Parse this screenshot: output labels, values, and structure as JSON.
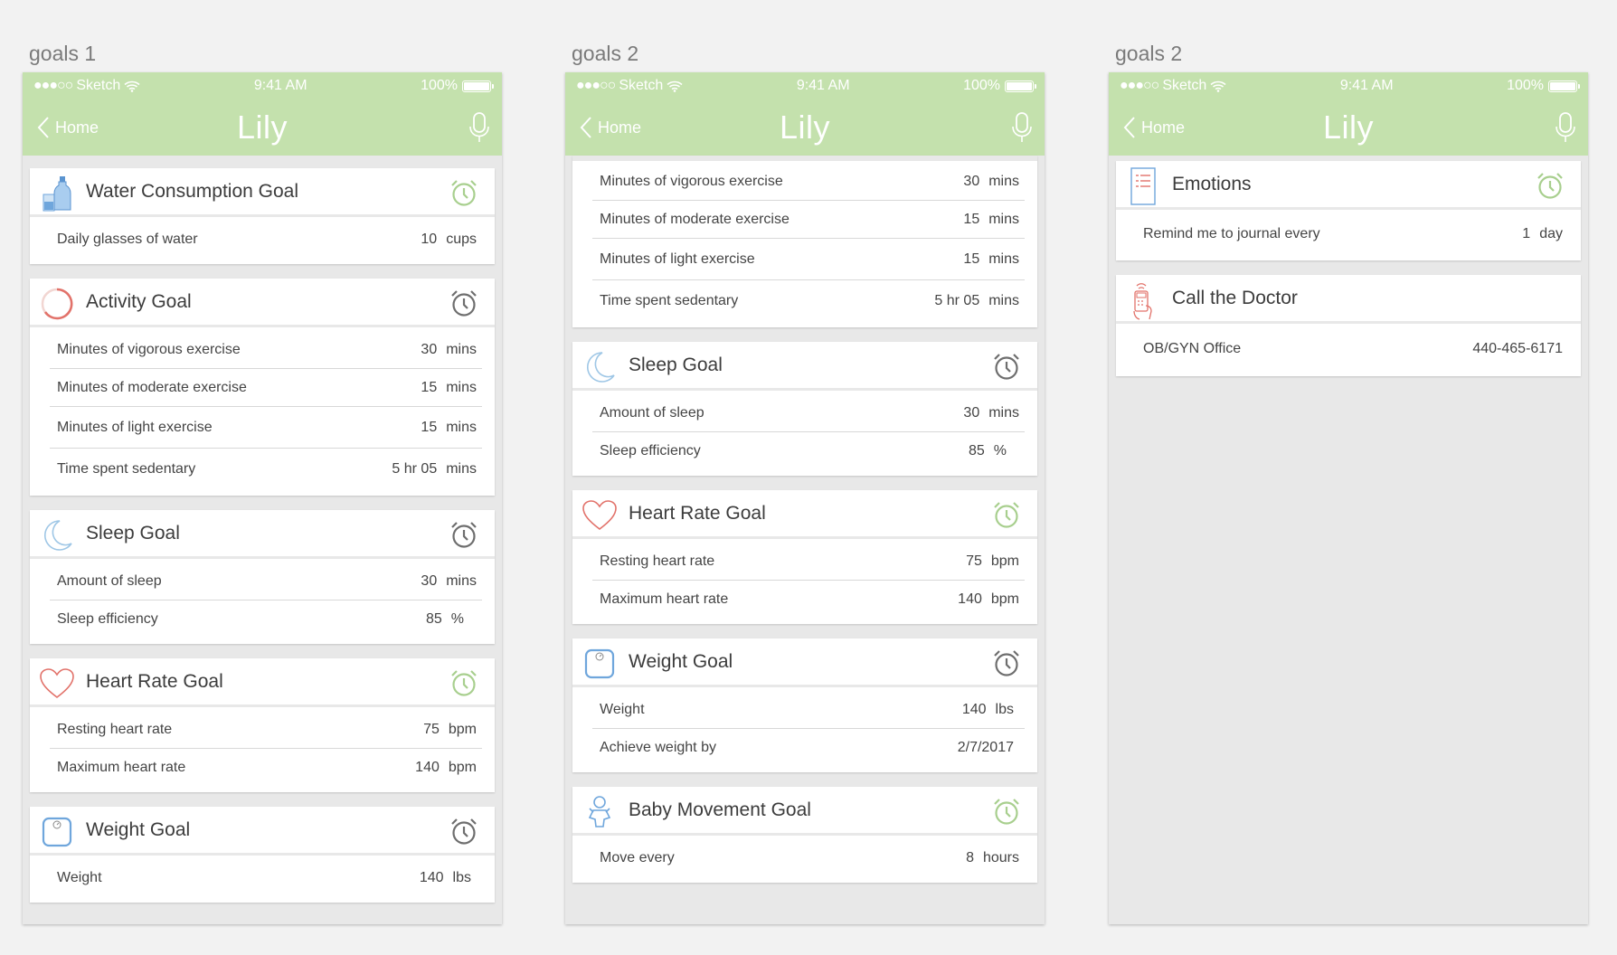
{
  "artboards": [
    {
      "label": "goals 1"
    },
    {
      "label": "goals 2"
    },
    {
      "label": "goals 2"
    }
  ],
  "status": {
    "carrier": "Sketch",
    "time": "9:41 AM",
    "battery": "100%"
  },
  "nav": {
    "back_label": "Home",
    "title": "Lily"
  },
  "colors": {
    "header_green": "#c4e1ad",
    "alarm_green": "#a8cf8e",
    "alarm_gray": "#6e6e6e",
    "heart_red": "#e2726a",
    "moon_blue": "#9fc7e6"
  },
  "screen1": {
    "water": {
      "title": "Water Consumption Goal",
      "rows": [
        {
          "label": "Daily glasses of water",
          "value": "10",
          "unit": "cups"
        }
      ]
    },
    "activity": {
      "title": "Activity Goal",
      "rows": [
        {
          "label": "Minutes of vigorous exercise",
          "value": "30",
          "unit": "mins"
        },
        {
          "label": "Minutes of moderate exercise",
          "value": "15",
          "unit": "mins"
        },
        {
          "label": "Minutes of light exercise",
          "value": "15",
          "unit": "mins"
        },
        {
          "label": "Time spent sedentary",
          "value": "5 hr  05",
          "unit": "mins"
        }
      ]
    },
    "sleep": {
      "title": "Sleep Goal",
      "rows": [
        {
          "label": "Amount of sleep",
          "value": "30",
          "unit": "mins"
        },
        {
          "label": "Sleep efficiency",
          "value": "85",
          "unit": "%"
        }
      ]
    },
    "heart": {
      "title": "Heart Rate Goal",
      "rows": [
        {
          "label": "Resting heart rate",
          "value": "75",
          "unit": "bpm"
        },
        {
          "label": "Maximum heart rate",
          "value": "140",
          "unit": "bpm"
        }
      ]
    },
    "weight": {
      "title": "Weight Goal",
      "rows": [
        {
          "label": "Weight",
          "value": "140",
          "unit": "lbs"
        }
      ]
    }
  },
  "screen2": {
    "activity_rows": [
      {
        "label": "Minutes of vigorous exercise",
        "value": "30",
        "unit": "mins"
      },
      {
        "label": "Minutes of moderate exercise",
        "value": "15",
        "unit": "mins"
      },
      {
        "label": "Minutes of light exercise",
        "value": "15",
        "unit": "mins"
      },
      {
        "label": "Time spent sedentary",
        "value": "5 hr  05",
        "unit": "mins"
      }
    ],
    "sleep": {
      "title": "Sleep Goal",
      "rows": [
        {
          "label": "Amount of sleep",
          "value": "30",
          "unit": "mins"
        },
        {
          "label": "Sleep efficiency",
          "value": "85",
          "unit": "%"
        }
      ]
    },
    "heart": {
      "title": "Heart Rate Goal",
      "rows": [
        {
          "label": "Resting heart rate",
          "value": "75",
          "unit": "bpm"
        },
        {
          "label": "Maximum heart rate",
          "value": "140",
          "unit": "bpm"
        }
      ]
    },
    "weight": {
      "title": "Weight Goal",
      "rows": [
        {
          "label": "Weight",
          "value": "140",
          "unit": "lbs"
        },
        {
          "label": "Achieve weight by",
          "value": "2/7/2017",
          "unit": ""
        }
      ]
    },
    "baby": {
      "title": "Baby Movement Goal",
      "rows": [
        {
          "label": "Move every",
          "value": "8",
          "unit": "hours"
        }
      ]
    }
  },
  "screen3": {
    "emotions": {
      "title": "Emotions",
      "rows": [
        {
          "label": "Remind me to journal every",
          "value": "1",
          "unit": "day"
        }
      ]
    },
    "doctor": {
      "title": "Call the Doctor",
      "rows": [
        {
          "label": "OB/GYN Office",
          "value": "440-465-6171",
          "unit": ""
        }
      ]
    }
  },
  "icons": [
    "water-bottle-icon",
    "activity-ring-icon",
    "moon-icon",
    "heart-icon",
    "scale-icon",
    "baby-icon",
    "journal-icon",
    "phone-icon",
    "alarm-clock-icon",
    "microphone-icon",
    "chevron-left-icon",
    "wifi-icon",
    "battery-icon"
  ]
}
